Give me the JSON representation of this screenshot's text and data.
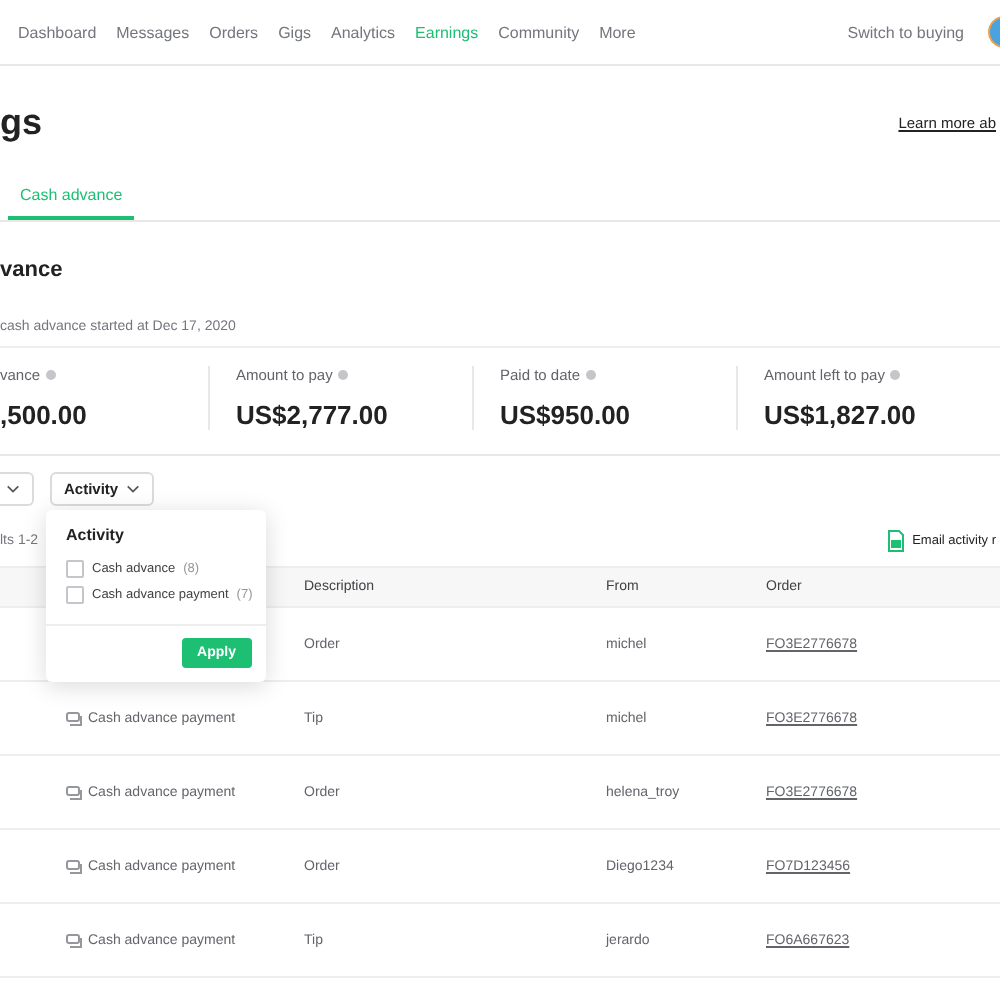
{
  "nav": {
    "items": [
      {
        "label": "Dashboard",
        "selected": false
      },
      {
        "label": "Messages",
        "selected": false
      },
      {
        "label": "Orders",
        "selected": false
      },
      {
        "label": "Gigs",
        "selected": false
      },
      {
        "label": "Analytics",
        "selected": false
      },
      {
        "label": "Earnings",
        "selected": true
      },
      {
        "label": "Community",
        "selected": false
      },
      {
        "label": "More",
        "selected": false
      }
    ],
    "switch_link": "Switch to buying"
  },
  "page_title": "gs",
  "learn_more": "Learn more ab",
  "tabs": [
    {
      "label": "Cash advance",
      "selected": true
    }
  ],
  "section_title": "vance",
  "subtitle": "cash advance started at Dec 17, 2020",
  "stats": [
    {
      "label": "vance",
      "value": ",500.00"
    },
    {
      "label": "Amount to pay",
      "value": "US$2,777.00"
    },
    {
      "label": "Paid to date",
      "value": "US$950.00"
    },
    {
      "label": "Amount left to pay",
      "value": "US$1,827.00"
    }
  ],
  "filters": [
    {
      "label": "Activity"
    }
  ],
  "results": "lts 1-2",
  "email_link": "Email activity r",
  "table": {
    "columns": [
      "Description",
      "From",
      "Order"
    ],
    "rows": [
      {
        "description": "Order",
        "from": "michel",
        "order": "FO3E2776678"
      },
      {
        "activity": "Cash advance payment",
        "description": "Tip",
        "from": "michel",
        "order": "FO3E2776678"
      },
      {
        "activity": "Cash advance payment",
        "description": "Order",
        "from": "helena_troy",
        "order": "FO3E2776678"
      },
      {
        "activity": "Cash advance payment",
        "description": "Order",
        "from": "Diego1234",
        "order": "FO7D123456"
      },
      {
        "activity": "Cash advance payment",
        "description": "Tip",
        "from": "jerardo",
        "order": "FO6A667623"
      }
    ]
  },
  "popup": {
    "title": "Activity",
    "options": [
      {
        "label": "Cash advance",
        "count": "(8)",
        "checked": false
      },
      {
        "label": "Cash advance payment",
        "count": "(7)",
        "checked": false
      }
    ],
    "apply": "Apply"
  }
}
